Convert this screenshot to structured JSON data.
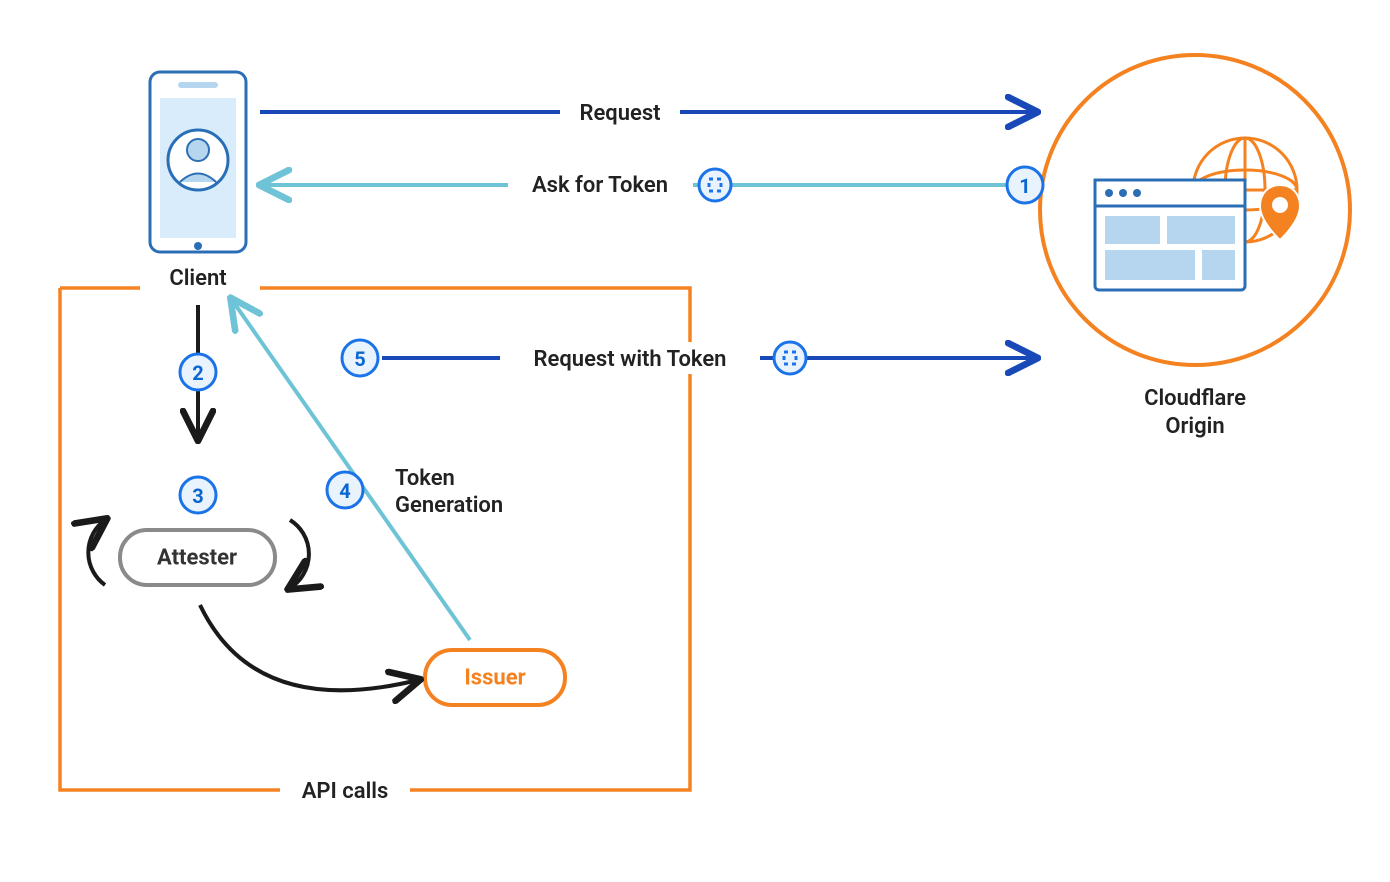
{
  "colors": {
    "blue": "#1949b8",
    "lightblue": "#6ec3d6",
    "orange": "#f58220",
    "black": "#1a1a1a",
    "gray": "#8a8a8a",
    "stepfill": "#e9f3fd",
    "stepstroke": "#1a73e8",
    "browserblue": "#b6d6f0"
  },
  "nodes": {
    "client": "Client",
    "attester": "Attester",
    "issuer": "Issuer",
    "origin1": "Cloudflare",
    "origin2": "Origin"
  },
  "arrows": {
    "request": "Request",
    "ask": "Ask for Token",
    "reqtoken": "Request with Token",
    "tokengen1": "Token",
    "tokengen2": "Generation"
  },
  "box": {
    "apicalls": "API calls"
  },
  "steps": {
    "s1": "1",
    "s2": "2",
    "s3": "3",
    "s4": "4",
    "s5": "5"
  }
}
